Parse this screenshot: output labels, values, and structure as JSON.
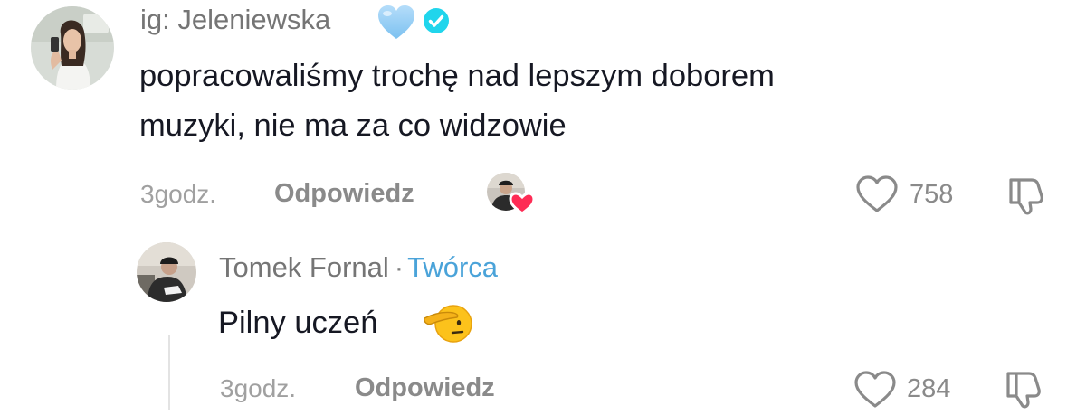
{
  "comments": [
    {
      "username": "ig: Jeleniewska",
      "text_lines": [
        "popracowaliśmy trochę nad lepszym doborem",
        "muzyki, nie ma za co widzowie"
      ],
      "time": "3godz.",
      "reply_label": "Odpowiedz",
      "likes": "758",
      "badges": [
        "light-blue-heart-emoji",
        "verified-badge"
      ],
      "creator_liked": true
    },
    {
      "username": "Tomek Fornal",
      "separator": "·",
      "role": "Twórca",
      "text": "Pilny uczeń",
      "time": "3godz.",
      "reply_label": "Odpowiedz",
      "likes": "284",
      "badges": [
        "saluting-face-emoji"
      ]
    }
  ],
  "colors": {
    "text_primary": "#161823",
    "text_secondary": "#757575",
    "meta": "#a0a0a0",
    "creator_accent": "#4aa3d9",
    "verified": "#20d5ec",
    "like_heart": "#fe2c55"
  }
}
